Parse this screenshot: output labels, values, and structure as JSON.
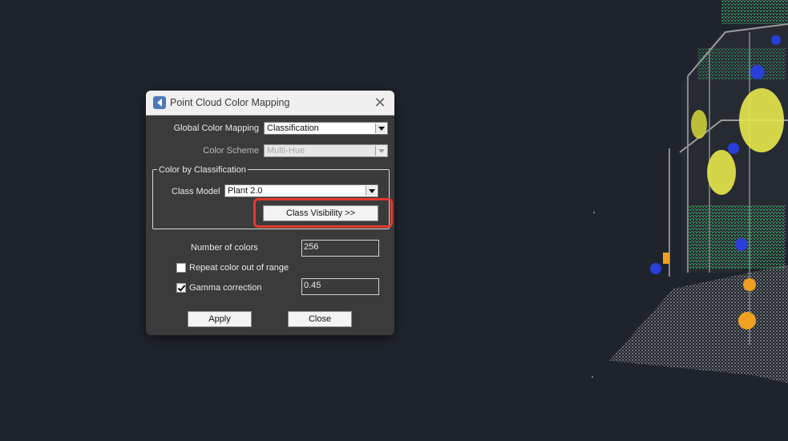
{
  "dialog": {
    "title": "Point Cloud Color Mapping",
    "close_icon": "close-icon",
    "app_icon": "app-icon"
  },
  "global_color_mapping": {
    "label": "Global Color Mapping",
    "value": "Classification"
  },
  "color_scheme": {
    "label": "Color Scheme",
    "value": "Multi-Hue",
    "enabled": false
  },
  "color_by_classification": {
    "group_label": "Color by Classification",
    "class_model_label": "Class Model",
    "class_model_value": "Plant 2.0",
    "class_visibility_button": "Class Visibility >>"
  },
  "number_of_colors": {
    "label": "Number of colors",
    "value": "256"
  },
  "repeat_color": {
    "label": "Repeat color out of range",
    "checked": false
  },
  "gamma_correction": {
    "label": "Gamma correction",
    "checked": true,
    "value": "0.45"
  },
  "buttons": {
    "apply": "Apply",
    "close": "Close"
  },
  "highlight": {
    "target": "class-visibility-button",
    "color": "#e53a2e"
  },
  "colors": {
    "background": "#1f242c",
    "dialog_body": "#3b3b3b",
    "titlebar": "#f0f0f0",
    "point_ground": "#b3b3b3",
    "point_green": "#22c55e",
    "point_yellow": "#e8e84a",
    "point_blue": "#2a3fd6",
    "point_orange": "#f0a020"
  }
}
